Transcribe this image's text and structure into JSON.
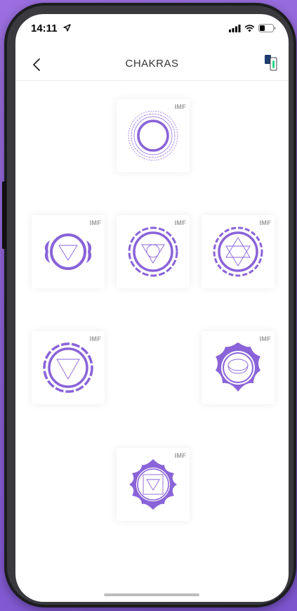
{
  "status_bar": {
    "time": "14:11"
  },
  "header": {
    "title": "CHAKRAS"
  },
  "tiles": [
    {
      "id": "crown",
      "badge": "IMF"
    },
    {
      "id": "third-eye",
      "badge": "IMF"
    },
    {
      "id": "throat",
      "badge": "IMF"
    },
    {
      "id": "heart",
      "badge": "IMF"
    },
    {
      "id": "solar-plexus",
      "badge": "IMF"
    },
    {
      "id": "sacral",
      "badge": "IMF"
    },
    {
      "id": "root",
      "badge": "IMF"
    }
  ],
  "colors": {
    "accent": "#8a63d8",
    "background": "#8a62d6"
  }
}
